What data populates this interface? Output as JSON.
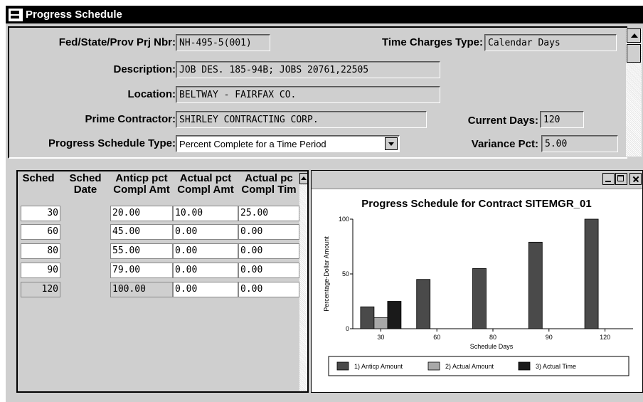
{
  "window": {
    "title": "Progress Schedule",
    "icon": "app-window-icon"
  },
  "fields": {
    "project_nbr_label": "Fed/State/Prov Prj Nbr:",
    "project_nbr": "NH-495-5(001)",
    "time_charges_label": "Time Charges Type:",
    "time_charges": "Calendar Days",
    "description_label": "Description:",
    "description": "JOB DES. 185-94B; JOBS 20761,22505",
    "location_label": "Location:",
    "location": "BELTWAY - FAIRFAX CO.",
    "prime_contractor_label": "Prime Contractor:",
    "prime_contractor": "SHIRLEY CONTRACTING CORP.",
    "current_days_label": "Current Days:",
    "current_days": "120",
    "schedule_type_label": "Progress Schedule Type:",
    "schedule_type": "Percent Complete for a Time Period",
    "variance_label": "Variance Pct:",
    "variance": "5.00"
  },
  "grid": {
    "headers": [
      {
        "line1": "Sched",
        "line2": ""
      },
      {
        "line1": "Sched",
        "line2": "Date"
      },
      {
        "line1": "Anticp pct",
        "line2": "Compl Amt"
      },
      {
        "line1": "Actual pct",
        "line2": "Compl Amt"
      },
      {
        "line1": "Actual pc",
        "line2": "Compl Tim"
      }
    ],
    "rows": [
      {
        "sched": "30",
        "date": "",
        "anticp": "20.00",
        "actual_amt": "10.00",
        "actual_time": "25.00"
      },
      {
        "sched": "60",
        "date": "",
        "anticp": "45.00",
        "actual_amt": "0.00",
        "actual_time": "0.00"
      },
      {
        "sched": "80",
        "date": "",
        "anticp": "55.00",
        "actual_amt": "0.00",
        "actual_time": "0.00"
      },
      {
        "sched": "90",
        "date": "",
        "anticp": "79.00",
        "actual_amt": "0.00",
        "actual_time": "0.00"
      },
      {
        "sched": "120",
        "date": "",
        "anticp": "100.00",
        "actual_amt": "0.00",
        "actual_time": "0.00"
      }
    ]
  },
  "chart_data": {
    "type": "bar",
    "title": "Progress Schedule for Contract  SITEMGR_01",
    "xlabel": "Schedule Days",
    "ylabel": "Percentage-Dollar Amount",
    "categories": [
      "30",
      "60",
      "80",
      "90",
      "120"
    ],
    "ylim": [
      0,
      100
    ],
    "yticks": [
      "0",
      "50",
      "100"
    ],
    "series": [
      {
        "name": "1) Anticp Amount",
        "color": "#4a4a4a",
        "values": [
          20,
          45,
          55,
          79,
          100
        ]
      },
      {
        "name": "2) Actual Amount",
        "color": "#a8a8a8",
        "values": [
          10,
          0,
          0,
          0,
          0
        ]
      },
      {
        "name": "3) Actual Time",
        "color": "#1a1a1a",
        "values": [
          25,
          0,
          0,
          0,
          0
        ]
      }
    ],
    "legend_position": "bottom"
  }
}
